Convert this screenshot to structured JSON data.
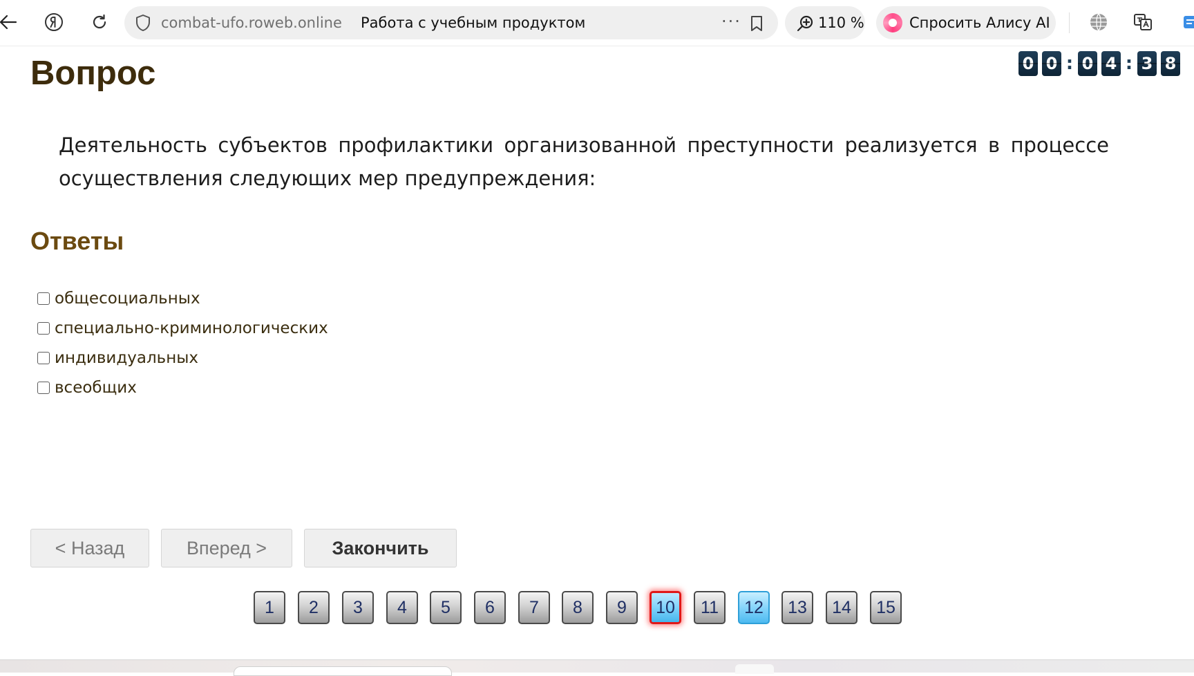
{
  "browser": {
    "host": "combat-ufo.roweb.online",
    "page_title": "Работа с учебным продуктом",
    "more_glyph": "···",
    "zoom": "110 %",
    "alice_label": "Спросить Алису AI",
    "icons": [
      "back-arrow-icon",
      "yandex-icon",
      "reload-icon",
      "shield-icon",
      "more-dots-icon",
      "bookmark-icon",
      "zoom-icon",
      "alice-icon",
      "globe-icon",
      "translate-icon",
      "extension-icon"
    ]
  },
  "timer": {
    "digits": [
      "0",
      "0",
      "0",
      "4",
      "3",
      "8"
    ],
    "separator": ":"
  },
  "question": {
    "heading": "Вопрос",
    "text": "Деятельность субъектов профилактики организованной преступности реализуется в процессе осуществления следующих мер предупреждения:"
  },
  "answers": {
    "heading": "Ответы",
    "options": [
      {
        "label": "общесоциальных",
        "checked": false
      },
      {
        "label": "специально-криминологических",
        "checked": false
      },
      {
        "label": "индивидуальных",
        "checked": false
      },
      {
        "label": "всеобщих",
        "checked": false
      }
    ]
  },
  "nav": {
    "back_label": "< Назад",
    "forward_label": "Вперед >",
    "finish_label": "Закончить"
  },
  "pagination": {
    "pages": [
      "1",
      "2",
      "3",
      "4",
      "5",
      "6",
      "7",
      "8",
      "9",
      "10",
      "11",
      "12",
      "13",
      "14",
      "15"
    ],
    "current": "10",
    "answered": [
      "12"
    ],
    "colors": {
      "current_border": "#e01818",
      "answered_fill": "#4dbaf0"
    }
  }
}
